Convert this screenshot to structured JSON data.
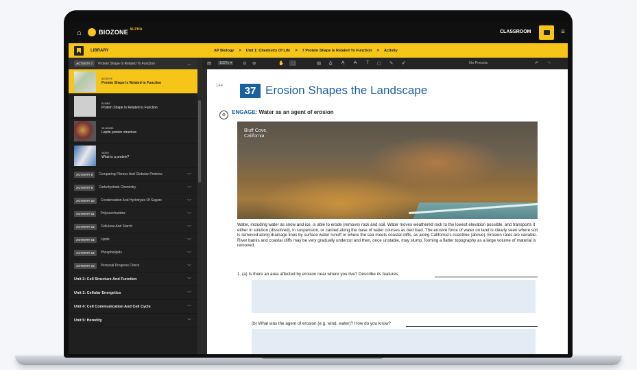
{
  "app": {
    "logo": "BIOZONE",
    "logo_badge": "ALPHA",
    "classroom_label": "CLASSROOM"
  },
  "library": {
    "title": "LIBRARY"
  },
  "breadcrumbs": [
    "AP Biology",
    "Unit 1: Chemistry Of Life",
    "7 Protein Shape Is Related To Function",
    "Activity"
  ],
  "sidebar": {
    "current_activity": {
      "badge": "ACTIVITY 7",
      "title": "Protein Shape Is Related To Function"
    },
    "resources": [
      {
        "kind": "ACTIVITY",
        "title": "Protein Shape Is Related to Function",
        "active": true
      },
      {
        "kind": "SLIDES",
        "title": "Protein Shape Is Related to Function",
        "active": false
      },
      {
        "kind": "3D MODEL",
        "title": "Leptin protein structure",
        "active": false
      },
      {
        "kind": "VIDEO",
        "title": "What is a protein?",
        "active": false
      }
    ],
    "activities": [
      {
        "badge": "ACTIVITY 8",
        "title": "Comparing Fibrous And Globular Proteins"
      },
      {
        "badge": "ACTIVITY 9",
        "title": "Carbohydrate Chemistry"
      },
      {
        "badge": "ACTIVITY 10",
        "title": "Condensation And Hydrolysis Of Sugars"
      },
      {
        "badge": "ACTIVITY 11",
        "title": "Polysaccharides"
      },
      {
        "badge": "ACTIVITY 12",
        "title": "Cellulose And Starch"
      },
      {
        "badge": "ACTIVITY 13",
        "title": "Lipids"
      },
      {
        "badge": "ACTIVITY 14",
        "title": "Phospholipids"
      },
      {
        "badge": "ACTIVITY 15",
        "title": "Personal Progress Check"
      }
    ],
    "units": [
      "Unit 2: Cell Structure And Function",
      "Unit 3: Cellular Energetics",
      "Unit 4: Cell Communication And Cell Cycle",
      "Unit 5: Heredity"
    ]
  },
  "toolbar": {
    "zoom": "182%",
    "presets": "No Presets"
  },
  "document": {
    "page_number": "144",
    "activity_number": "37",
    "title": "Erosion Shapes the Landscape",
    "engage_label": "ENGAGE:",
    "engage_text": "Water as an agent of erosion",
    "photo_caption_1": "Bluff Cove,",
    "photo_caption_2": "California",
    "paragraph": "Water, including water as snow and ice, is able to erode (remove) rock and soil. Water moves weathered rock to the lowest elevation possible, and transports it either in solution (dissolved), in suspension, or carried along the base of water courses as bed load. The erosive force of water on land is clearly seen where soil is removed along drainage lines by surface water runoff or where the sea meets coastal cliffs, as along California's coastline (above). Erosion rates are variable. River banks and coastal cliffs may be very gradually undercut and then, once unstable, may slump, forming a flatter topography as a large volume of material is removed.",
    "q1a": "1.   (a) Is there an area affected by erosion near where you live? Describe its features:",
    "q1b": "(b) What was the agent of erosion (e.g. wind, water)? How do you know?"
  }
}
